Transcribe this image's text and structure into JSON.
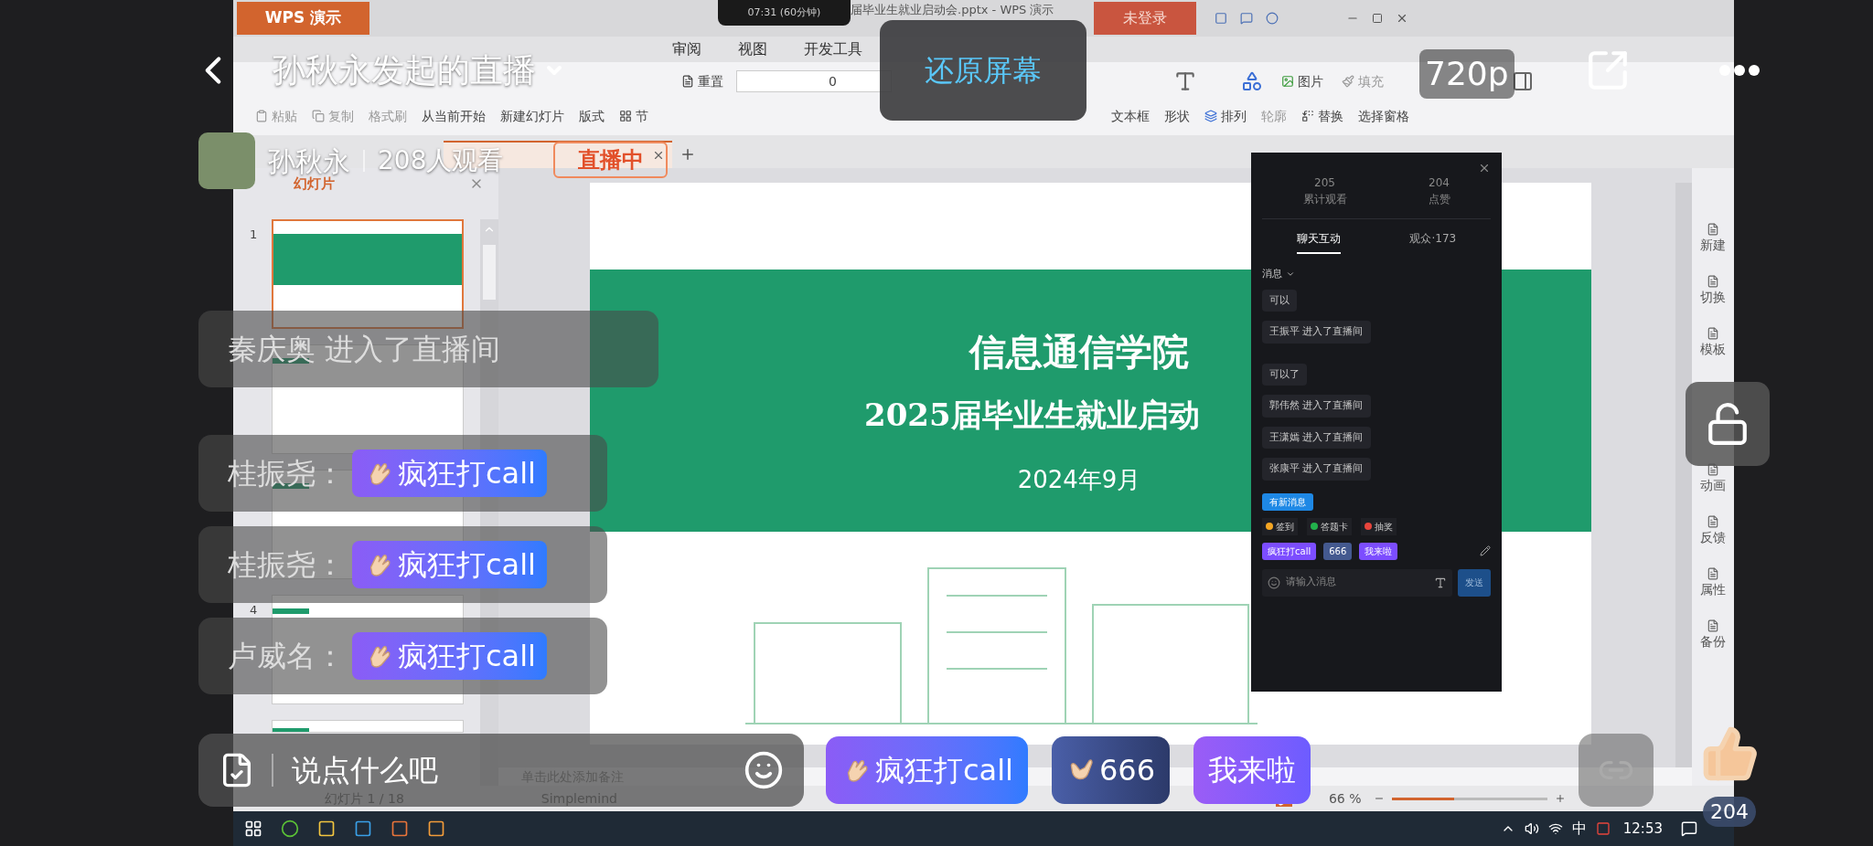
{
  "header": {
    "title": "孙秋永发起的直播",
    "restore_button": "还原屏幕",
    "quality": "720p",
    "host_name": "孙秋永",
    "viewers": "208人观看",
    "live_badge": "直播中"
  },
  "wps": {
    "app_tab": "WPS 演示",
    "recording_timer": "07:31 (60分钟)",
    "window_title": "届毕业生就业启动会.pptx - WPS 演示",
    "login_button": "未登录",
    "menu": [
      "审阅",
      "视图",
      "开发工具"
    ],
    "ribbon": {
      "reset": "重置",
      "font_size": "0",
      "picture": "图片",
      "fill": "填充",
      "paste": "粘贴",
      "copy": "复制",
      "format_painter": "格式刷",
      "from_current": "从当前开始",
      "new_slide": "新建幻灯片",
      "layout": "版式",
      "section": "节",
      "text_box": "文本框",
      "shape": "形状",
      "arrange": "排列",
      "outline": "轮廓",
      "replace": "替换",
      "selection_pane": "选择窗格"
    },
    "panel_tabs": [
      {
        "label": "幻灯片",
        "selected": true
      }
    ],
    "thumbnails": [
      {
        "number": "1",
        "selected": true
      },
      {
        "selected": false
      },
      {
        "selected": false
      },
      {
        "number": "4",
        "selected": false
      },
      {
        "selected": false
      }
    ],
    "slide": {
      "title": "信息通信学院",
      "subtitle": "2025届毕业生就业启动",
      "date": "2024年9月"
    },
    "notes_placeholder": "单击此处添加备注",
    "sidebar": [
      "新建",
      "切换",
      "模板",
      "动画",
      "反馈",
      "属性",
      "备份"
    ],
    "status_bar": {
      "slide_count": "幻灯片 1 / 18",
      "theme": "Simplemind",
      "zoom": "66 %",
      "zoom_slider": {
        "level": 0.4
      }
    },
    "taskbar": {
      "ime": "中",
      "time": "12:53"
    }
  },
  "live_panel": {
    "stats": [
      {
        "value": "205",
        "label": "累计观看"
      },
      {
        "value": "204",
        "label": "点赞"
      }
    ],
    "tabs": [
      {
        "label": "聊天互动",
        "selected": true
      },
      {
        "label": "观众·173",
        "selected": false
      }
    ],
    "filter": "消息",
    "messages": [
      "可以",
      "王振平 进入了直播间",
      "可以了",
      "郭伟然 进入了直播间",
      "王潇嫣 进入了直播间",
      "张康平 进入了直播间"
    ],
    "new_messages_button": "有新消息",
    "actions": [
      {
        "label": "签到",
        "color": "#f5a623"
      },
      {
        "label": "答题卡",
        "color": "#22b14c"
      },
      {
        "label": "抽奖",
        "color": "#e8453c"
      }
    ],
    "quick_gifts": [
      "疯狂打call",
      "666",
      "我来啦"
    ],
    "input_placeholder": "请输入消息",
    "send_button": "发送"
  },
  "chat": [
    {
      "kind": "notice",
      "text": "秦庆奥 进入了直播间"
    },
    {
      "kind": "gift",
      "name": "桂振尧：",
      "gift": "疯狂打call"
    },
    {
      "kind": "gift",
      "name": "桂振尧：",
      "gift": "疯狂打call"
    },
    {
      "kind": "gift",
      "name": "卢威名：",
      "gift": "疯狂打call"
    }
  ],
  "bottom_bar": {
    "placeholder": "说点什么吧",
    "gifts": [
      {
        "kind": "clap",
        "label": "疯狂打call"
      },
      {
        "kind": "shaka",
        "label": "666"
      },
      {
        "kind": "plain",
        "label": "我来啦"
      }
    ],
    "likes": "204"
  }
}
